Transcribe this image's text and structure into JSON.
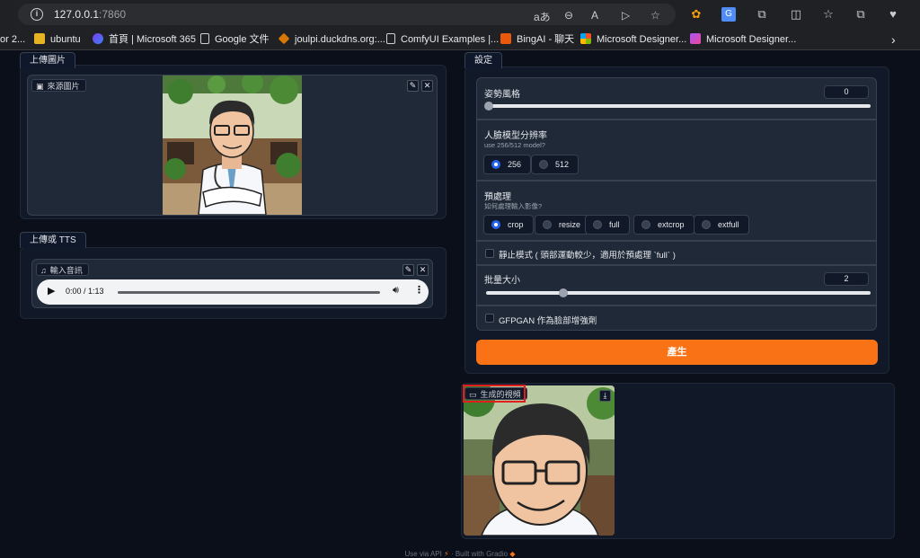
{
  "browser": {
    "url_host": "127.0.0.1",
    "url_port": ":7860",
    "bookmarks": [
      {
        "label": "or 2..."
      },
      {
        "label": "ubuntu"
      },
      {
        "label": "首頁 | Microsoft 365"
      },
      {
        "label": "Google 文件"
      },
      {
        "label": "joulpi.duckdns.org:..."
      },
      {
        "label": "ComfyUI Examples |..."
      },
      {
        "label": "BingAI - 聊天"
      },
      {
        "label": "Microsoft Designer..."
      },
      {
        "label": "Microsoft Designer..."
      }
    ]
  },
  "upload_image": {
    "tab": "上傳圖片",
    "source_label": "來源圖片"
  },
  "upload_audio": {
    "tab": "上傳或 TTS",
    "audio_label": "輸入音訊",
    "time": "0:00 / 1:13"
  },
  "settings": {
    "tab": "設定",
    "pose_style": {
      "label": "姿勢風格",
      "value": "0",
      "fraction": 0.0
    },
    "face_resolution": {
      "label": "人臉模型分辨率",
      "sub": "use 256/512 model?",
      "options": [
        "256",
        "512"
      ],
      "selected": "256"
    },
    "preprocess": {
      "label": "預處理",
      "sub": "如何處理輸入影像?",
      "options": [
        "crop",
        "resize",
        "full",
        "extcrop",
        "extfull"
      ],
      "selected": "crop"
    },
    "still_mode": {
      "label": "靜止模式 ( 頭部運動較少，適用於預處理 `full` )",
      "checked": false
    },
    "batch_size": {
      "label": "批量大小",
      "value": "2",
      "fraction": 0.2
    },
    "gfpgan": {
      "label": "GFPGAN 作為臉部增強劑",
      "checked": false
    },
    "generate_label": "產生"
  },
  "output": {
    "video_label": "生成的視頻"
  },
  "footer": {
    "use_api": "Use via API",
    "separator": "·",
    "built_with": "Built with Gradio"
  },
  "colors": {
    "accent": "#f97316",
    "radio_selected": "#2563eb",
    "highlight": "#e11d1d"
  }
}
